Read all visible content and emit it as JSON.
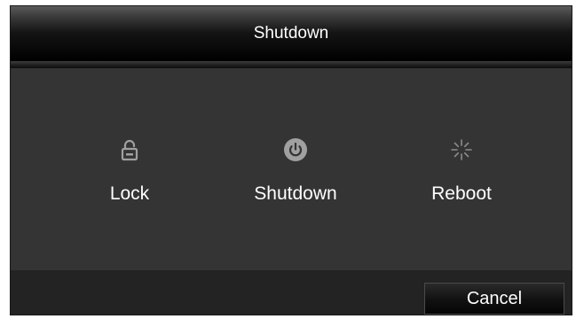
{
  "dialog": {
    "title": "Shutdown"
  },
  "options": [
    {
      "label": "Lock",
      "icon": "lock-icon"
    },
    {
      "label": "Shutdown",
      "icon": "power-icon"
    },
    {
      "label": "Reboot",
      "icon": "reboot-icon"
    }
  ],
  "footer": {
    "cancel_label": "Cancel"
  },
  "colors": {
    "dialog_background": "#333333",
    "footer_background": "#232323",
    "text": "#ffffff",
    "icon_gray": "#a0a0a0"
  }
}
